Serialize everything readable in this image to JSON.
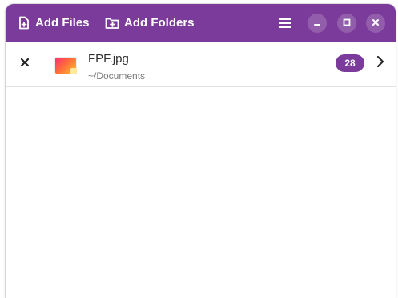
{
  "window": {
    "accent_color": "#7b3b9a"
  },
  "headerbar": {
    "add_files_label": "Add Files",
    "add_files_icon": "add-file-icon",
    "add_folders_label": "Add Folders",
    "add_folders_icon": "add-folder-icon",
    "menu_icon": "hamburger-menu-icon",
    "window_controls": [
      "minimize-icon",
      "maximize-icon",
      "close-icon"
    ]
  },
  "files": [
    {
      "name": "FPF.jpg",
      "path": "~/Documents",
      "count": "28",
      "thumbnail_icon": "image-thumbnail-icon",
      "remove_icon": "close-icon",
      "open_icon": "chevron-right-icon"
    }
  ]
}
